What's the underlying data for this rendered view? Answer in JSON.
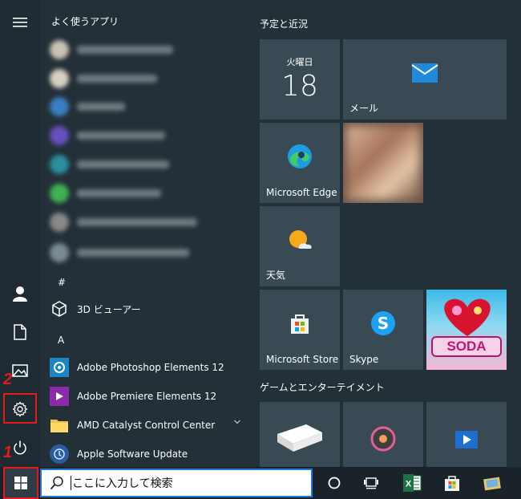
{
  "apps_list": {
    "title": "よく使うアプリ",
    "section_hash": "#",
    "section_a": "A",
    "items": [
      {
        "label": "3D ビューアー"
      },
      {
        "label": "Adobe Photoshop Elements 12"
      },
      {
        "label": "Adobe Premiere Elements 12"
      },
      {
        "label": "AMD Catalyst Control Center"
      },
      {
        "label": "Apple Software Update"
      }
    ]
  },
  "tiles": {
    "group1_title": "予定と近況",
    "group2_title": "ゲームとエンターテイメント",
    "calendar_day": "火曜日",
    "calendar_date": "18",
    "mail": "メール",
    "edge": "Microsoft Edge",
    "weather": "天気",
    "store": "Microsoft Store",
    "skype": "Skype",
    "candy_text": "SODA"
  },
  "taskbar": {
    "search_placeholder": "ここに入力して検索"
  },
  "annotations": {
    "label1": "1",
    "label2": "2"
  },
  "colors": {
    "accent_red": "#e51a1a",
    "search_border": "#1e7bd6"
  }
}
